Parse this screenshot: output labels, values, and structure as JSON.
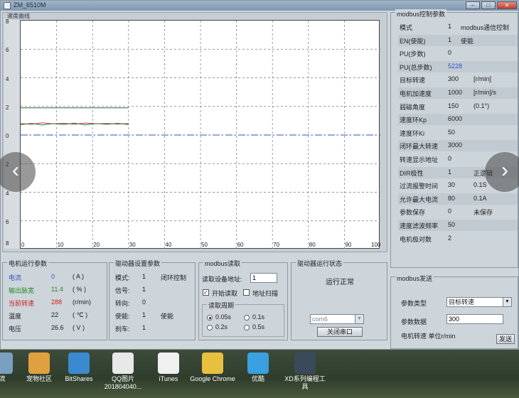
{
  "window": {
    "title": "ZM_6510M",
    "min_label": "–",
    "max_label": "□",
    "close_label": "✕"
  },
  "chart": {
    "title": "速度曲线",
    "y_labels": [
      "8",
      "6",
      "4",
      "2",
      "0",
      "2",
      "4",
      "6",
      "8"
    ],
    "x_labels": [
      "0",
      "10",
      "20",
      "30",
      "40",
      "50",
      "60",
      "70",
      "80",
      "90",
      "100"
    ]
  },
  "chart_data": {
    "type": "line",
    "xlim": [
      0,
      100
    ],
    "ylim": [
      -8,
      8
    ],
    "series": [
      {
        "color": "#2a6e3a",
        "x": [
          0,
          30
        ],
        "y": [
          1.9,
          1.9
        ]
      },
      {
        "color": "#c03030",
        "x": [
          0,
          3,
          6,
          9,
          12,
          15,
          18,
          21,
          24,
          27,
          30
        ],
        "y": [
          0.8,
          0.75,
          0.85,
          0.78,
          0.82,
          0.76,
          0.84,
          0.79,
          0.81,
          0.77,
          0.8
        ]
      },
      {
        "color": "#2a7a40",
        "x": [
          0,
          3,
          6,
          9,
          12,
          15,
          18,
          21,
          24,
          27,
          30
        ],
        "y": [
          0.72,
          0.82,
          0.7,
          0.8,
          0.74,
          0.83,
          0.71,
          0.8,
          0.75,
          0.82,
          0.73
        ]
      },
      {
        "color": "#2b4fd0",
        "x": [
          0,
          100
        ],
        "y": [
          0,
          0
        ]
      }
    ]
  },
  "motor": {
    "title": "电机运行参数",
    "rows": [
      {
        "label": "电流",
        "value": "0",
        "unit": "( A )",
        "color": "#2b55cc"
      },
      {
        "label": "输出脉宽",
        "value": "11.4",
        "unit": "( % )",
        "color": "#2a8a2a"
      },
      {
        "label": "当前转速",
        "value": "288",
        "unit": "(r/min)",
        "color": "#cc2222"
      },
      {
        "label": "温度",
        "value": "22",
        "unit": "( ℃ )",
        "color": "#222222"
      },
      {
        "label": "电压",
        "value": "26.6",
        "unit": "( V )",
        "color": "#222222"
      }
    ]
  },
  "driver_settings": {
    "title": "驱动器设置参数",
    "rows": [
      {
        "label": "模式:",
        "value": "1",
        "extra": "闭环控制"
      },
      {
        "label": "信号:",
        "value": "1",
        "extra": ""
      },
      {
        "label": "转向:",
        "value": "0",
        "extra": ""
      },
      {
        "label": "使能:",
        "value": "1",
        "extra": "使能"
      },
      {
        "label": "刹车:",
        "value": "1",
        "extra": ""
      }
    ]
  },
  "modbus_read": {
    "title": "modbus读取",
    "addr_label": "读取设备地址:",
    "addr_value": "1",
    "start_label": "开始读取",
    "scan_label": "地址扫描",
    "period_title": "读取周期",
    "periods": [
      "0.05s",
      "0.1s",
      "0.2s",
      "0.5s"
    ]
  },
  "driver_status": {
    "title": "驱动器运行状态",
    "status": "运行正常",
    "port": "com6",
    "close_port_label": "关闭串口"
  },
  "modbus_control": {
    "title": "modbus控制参数",
    "rows": [
      {
        "label": "模式",
        "value": "1",
        "extra": "modbus通信控制"
      },
      {
        "label": "EN(使能)",
        "value": "1",
        "extra": "使能"
      },
      {
        "label": "PU(步数)",
        "value": "0",
        "extra": ""
      },
      {
        "label": "PU(总步数)",
        "value": "5228",
        "extra": ""
      },
      {
        "label": "目标转速",
        "value": "300",
        "extra": "[r/min]"
      },
      {
        "label": "电机加速度",
        "value": "1000",
        "extra": "[r/min]/s"
      },
      {
        "label": "弱磁角度",
        "value": "150",
        "extra": "(0.1°)"
      },
      {
        "label": "速度环Kp",
        "value": "6000",
        "extra": ""
      },
      {
        "label": "速度环Ki",
        "value": "50",
        "extra": ""
      },
      {
        "label": "闭环最大转速",
        "value": "3000",
        "extra": ""
      },
      {
        "label": "转速显示地址",
        "value": "0",
        "extra": ""
      },
      {
        "label": "DIR极性",
        "value": "1",
        "extra": "正逻辑"
      },
      {
        "label": "过流报警时间",
        "value": "30",
        "extra": "0.1S"
      },
      {
        "label": "允许最大电流",
        "value": "80",
        "extra": "0.1A"
      },
      {
        "label": "参数保存",
        "value": "0",
        "extra": "未保存"
      },
      {
        "label": "速度滤波频率",
        "value": "50",
        "extra": ""
      },
      {
        "label": "电机极对数",
        "value": "2",
        "extra": ""
      }
    ]
  },
  "modbus_send": {
    "title": "modbus发送",
    "param_type_label": "参数类型",
    "param_type_value": "目标转速",
    "param_data_label": "参数数据",
    "param_data_value": "300",
    "unit_hint": "电机转速 单位r/min",
    "send_label": "发送"
  },
  "desktop": {
    "icons": [
      {
        "label": "流",
        "color": "#7aa0c0"
      },
      {
        "label": "宠物社区",
        "color": "#e0a040"
      },
      {
        "label": "BitShares",
        "color": "#3a8ad0"
      },
      {
        "label": "QQ图片 201804040...",
        "color": "#e8e8e8"
      },
      {
        "label": "iTunes",
        "color": "#f0f0f0"
      },
      {
        "label": "Google Chrome",
        "color": "#e8c040"
      },
      {
        "label": "优酷",
        "color": "#3aa0e0"
      },
      {
        "label": "XD系列编程工具",
        "color": "#3a4a5a"
      }
    ]
  },
  "nav": {
    "prev": "‹",
    "next": "›"
  }
}
